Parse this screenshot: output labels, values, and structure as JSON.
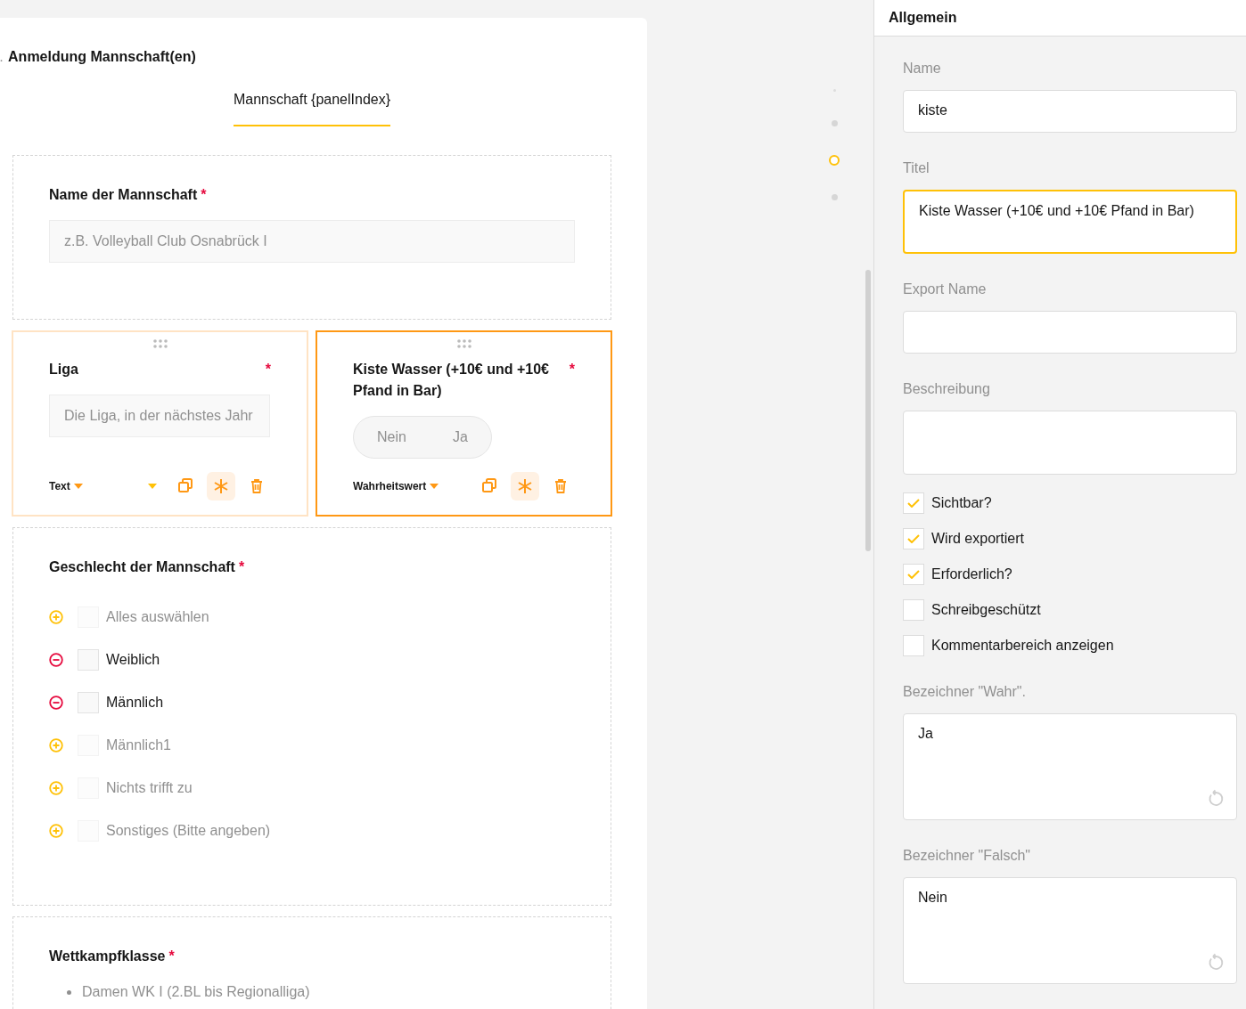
{
  "question": {
    "number": ".",
    "title": "Anmeldung Mannschaft(en)"
  },
  "tabs": [
    {
      "label": "Mannschaft {panelIndex}",
      "selected": true
    }
  ],
  "team_name": {
    "label": "Name der Mannschaft",
    "required_mark": "*",
    "placeholder": "z.B. Volleyball Club Osnabrück I"
  },
  "cards": [
    {
      "kind": "text",
      "label": "Liga",
      "required_mark": "*",
      "selected": false,
      "placeholder": "Die Liga, in der nächstes Jahr",
      "type": "Text"
    },
    {
      "kind": "boolean",
      "label": "Kiste Wasser (+10€ und +10€ Pfand in Bar)",
      "required_mark": "*",
      "selected": true,
      "false_label": "Nein",
      "true_label": "Ja",
      "type": "Wahrheitswert"
    }
  ],
  "gender": {
    "label": "Geschlecht der Mannschaft",
    "required_mark": "*",
    "choices": [
      {
        "label": "Alles auswählen",
        "included": false,
        "checked": false
      },
      {
        "label": "Weiblich",
        "included": true,
        "checked": false
      },
      {
        "label": "Männlich",
        "included": true,
        "checked": false
      },
      {
        "label": "Männlich1",
        "included": false,
        "checked": false
      },
      {
        "label": "Nichts trifft zu",
        "included": false,
        "checked": false
      },
      {
        "label": "Sonstiges (Bitte angeben)",
        "included": false,
        "checked": false
      }
    ]
  },
  "competition": {
    "label": "Wettkampfklasse",
    "required_mark": "*",
    "items": [
      "Damen WK I (2.BL bis Regionalliga)"
    ]
  },
  "page_dots": [
    {
      "selected": false
    },
    {
      "selected": false
    },
    {
      "selected": true
    },
    {
      "selected": false
    }
  ],
  "properties": {
    "tab": "Allgemein",
    "name": {
      "label": "Name",
      "value": "kiste"
    },
    "title": {
      "label": "Titel",
      "value": "Kiste Wasser (+10€ und +10€ Pfand in Bar)"
    },
    "export_name": {
      "label": "Export Name"
    },
    "description": {
      "label": "Beschreibung"
    },
    "checks": [
      {
        "label": "Sichtbar?",
        "checked": true
      },
      {
        "label": "Wird exportiert",
        "checked": true
      },
      {
        "label": "Erforderlich?",
        "checked": true
      },
      {
        "label": "Schreibgeschützt",
        "checked": false
      },
      {
        "label": "Kommentarbereich anzeigen",
        "checked": false
      }
    ],
    "true_label": {
      "label": "Bezeichner \"Wahr\".",
      "value": "Ja"
    },
    "false_label": {
      "label": "Bezeichner \"Falsch\"",
      "value": "Nein"
    }
  }
}
